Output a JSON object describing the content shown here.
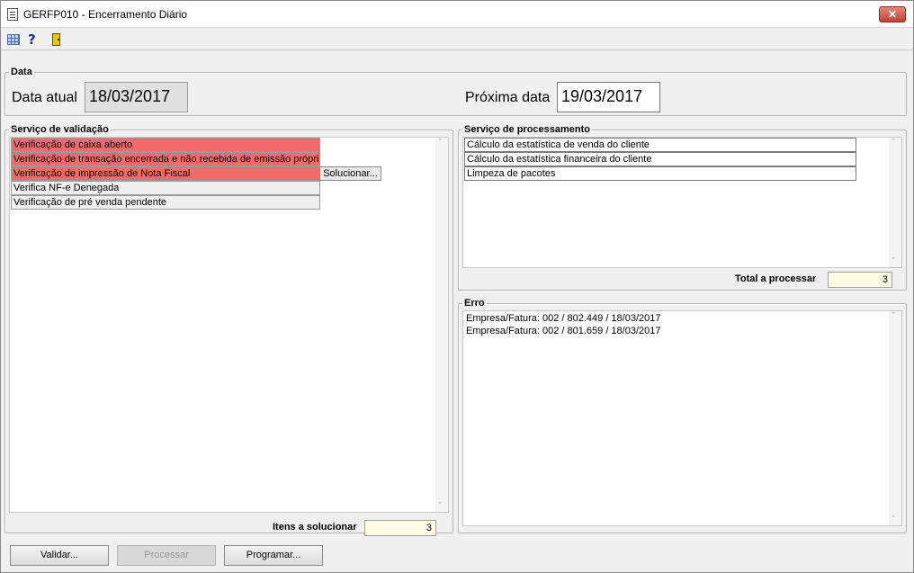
{
  "window": {
    "title": "GERFP010 - Encerramento Diário",
    "close_label": "✕"
  },
  "toolbar": {
    "help_glyph": "?"
  },
  "data_group": {
    "legend": "Data",
    "current_label": "Data atual",
    "current_value": "18/03/2017",
    "next_label": "Próxima data",
    "next_value": "19/03/2017"
  },
  "validation": {
    "legend": "Serviço de validação",
    "items": [
      {
        "label": "Verificação de caixa aberto",
        "status": "error"
      },
      {
        "label": "Verificação de transação encerrada e não recebida de emissão própri",
        "status": "error"
      },
      {
        "label": "Verificação de impressão de Nota Fiscal",
        "status": "error"
      },
      {
        "label": "Verifica NF-e Denegada",
        "status": "ok"
      },
      {
        "label": "Verificação de pré venda pendente",
        "status": "ok"
      }
    ],
    "solve_button": "Solucionar...",
    "count_label": "Itens a solucionar",
    "count_value": "3"
  },
  "processing": {
    "legend": "Serviço de processamento",
    "items": [
      "Cálculo da estatística de venda do cliente",
      "Cálculo da estatística financeira do cliente",
      "Limpeza de pacotes"
    ],
    "count_label": "Total a processar",
    "count_value": "3"
  },
  "error": {
    "legend": "Erro",
    "lines": [
      "Empresa/Fatura: 002 / 802.449 / 18/03/2017",
      "Empresa/Fatura: 002 / 801.659 / 18/03/2017"
    ]
  },
  "buttons": {
    "validate": "Validar...",
    "process": "Processar",
    "schedule": "Programar..."
  },
  "colors": {
    "error_row": "#f26b6b",
    "count_box": "#fffde6"
  }
}
